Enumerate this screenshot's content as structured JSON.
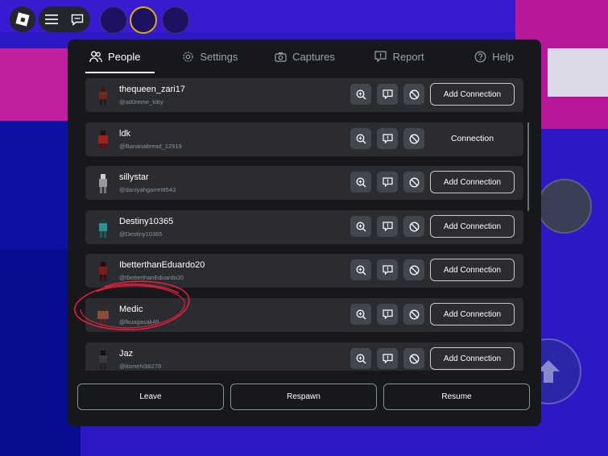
{
  "tabs": [
    {
      "label": "People",
      "icon": "people-icon",
      "active": true
    },
    {
      "label": "Settings",
      "icon": "gear-icon",
      "active": false
    },
    {
      "label": "Captures",
      "icon": "camera-icon",
      "active": false
    },
    {
      "label": "Report",
      "icon": "report-icon",
      "active": false
    },
    {
      "label": "Help",
      "icon": "help-icon",
      "active": false
    }
  ],
  "players": [
    {
      "name": "thequeen_zari17",
      "handle": "@ad0reme_kitty",
      "action": "Add Connection",
      "avatar_color": "#6b2a22"
    },
    {
      "name": "ldk",
      "handle": "@Bananabread_12919",
      "action": "Connection",
      "avatar_color": "#a0201e"
    },
    {
      "name": "sillystar",
      "handle": "@daniyahgarrettt543",
      "action": "Add Connection",
      "avatar_color": "#9a9a98"
    },
    {
      "name": "Destiny10365",
      "handle": "@Destiny10365",
      "action": "Add Connection",
      "avatar_color": "#2f8f8a"
    },
    {
      "name": "IbetterthanEduardo20",
      "handle": "@IbetterthanEduardo20",
      "action": "Add Connection",
      "avatar_color": "#7a1d1d"
    },
    {
      "name": "Medic",
      "handle": "@lkuagasak45",
      "action": "Add Connection",
      "avatar_color": "#8a4a3a"
    },
    {
      "name": "Jaz",
      "handle": "@itsmehi98278",
      "action": "Add Connection",
      "avatar_color": "#3a3a3a"
    }
  ],
  "footer": {
    "leave": "Leave",
    "respawn": "Respawn",
    "resume": "Resume"
  },
  "colors": {
    "panel": "#17181c",
    "row": "#2a2c31",
    "annotation": "#e0203a"
  }
}
